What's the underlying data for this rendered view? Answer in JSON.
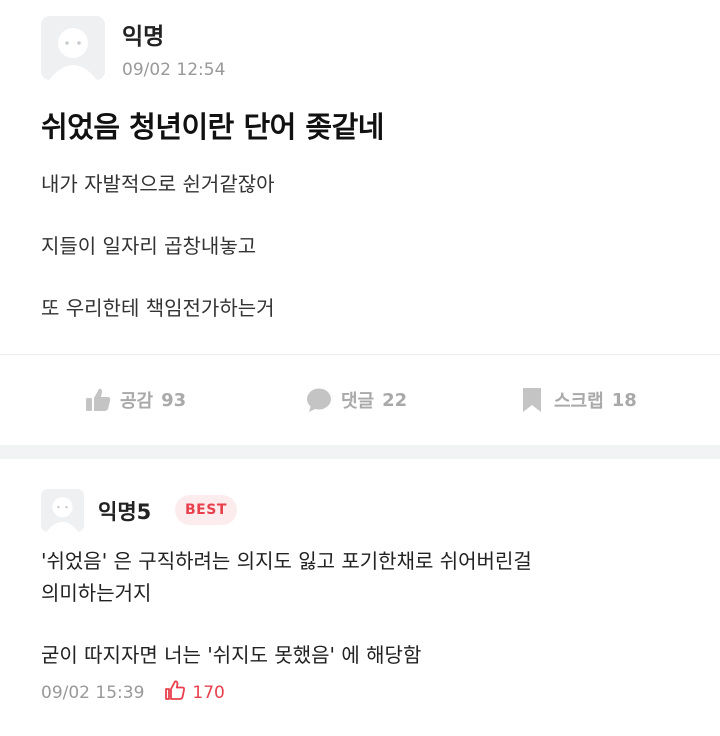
{
  "post": {
    "author": "익명",
    "time": "09/02 12:54",
    "title": "쉬었음 청년이란 단어 좆같네",
    "body": [
      "내가 자발적으로 쉰거같잖아",
      "지들이 일자리 곱창내놓고",
      "또 우리한테 책임전가하는거"
    ],
    "actions": {
      "like_label": "공감",
      "like_count": "93",
      "comment_label": "댓글",
      "comment_count": "22",
      "scrap_label": "스크랩",
      "scrap_count": "18"
    }
  },
  "comment": {
    "author": "익명5",
    "badge": "BEST",
    "lines": [
      "'쉬었음' 은 구직하려는 의지도 잃고 포기한채로 쉬어버린걸",
      "의미하는거지",
      "굳이 따지자면 너는 '쉬지도 못했음' 에 해당함"
    ],
    "time": "09/02 15:39",
    "likes": "170"
  },
  "colors": {
    "action_gray": "#a9a9a9",
    "badge_red": "#e8404c",
    "badge_bg": "#fdecee",
    "timestamp_gray": "#999999"
  },
  "icons": {
    "avatar": "default-avatar-icon",
    "like": "thumbs-up-icon",
    "comment": "speech-bubble-icon",
    "scrap": "bookmark-icon",
    "comment_like": "thumbs-up-outline-icon"
  }
}
